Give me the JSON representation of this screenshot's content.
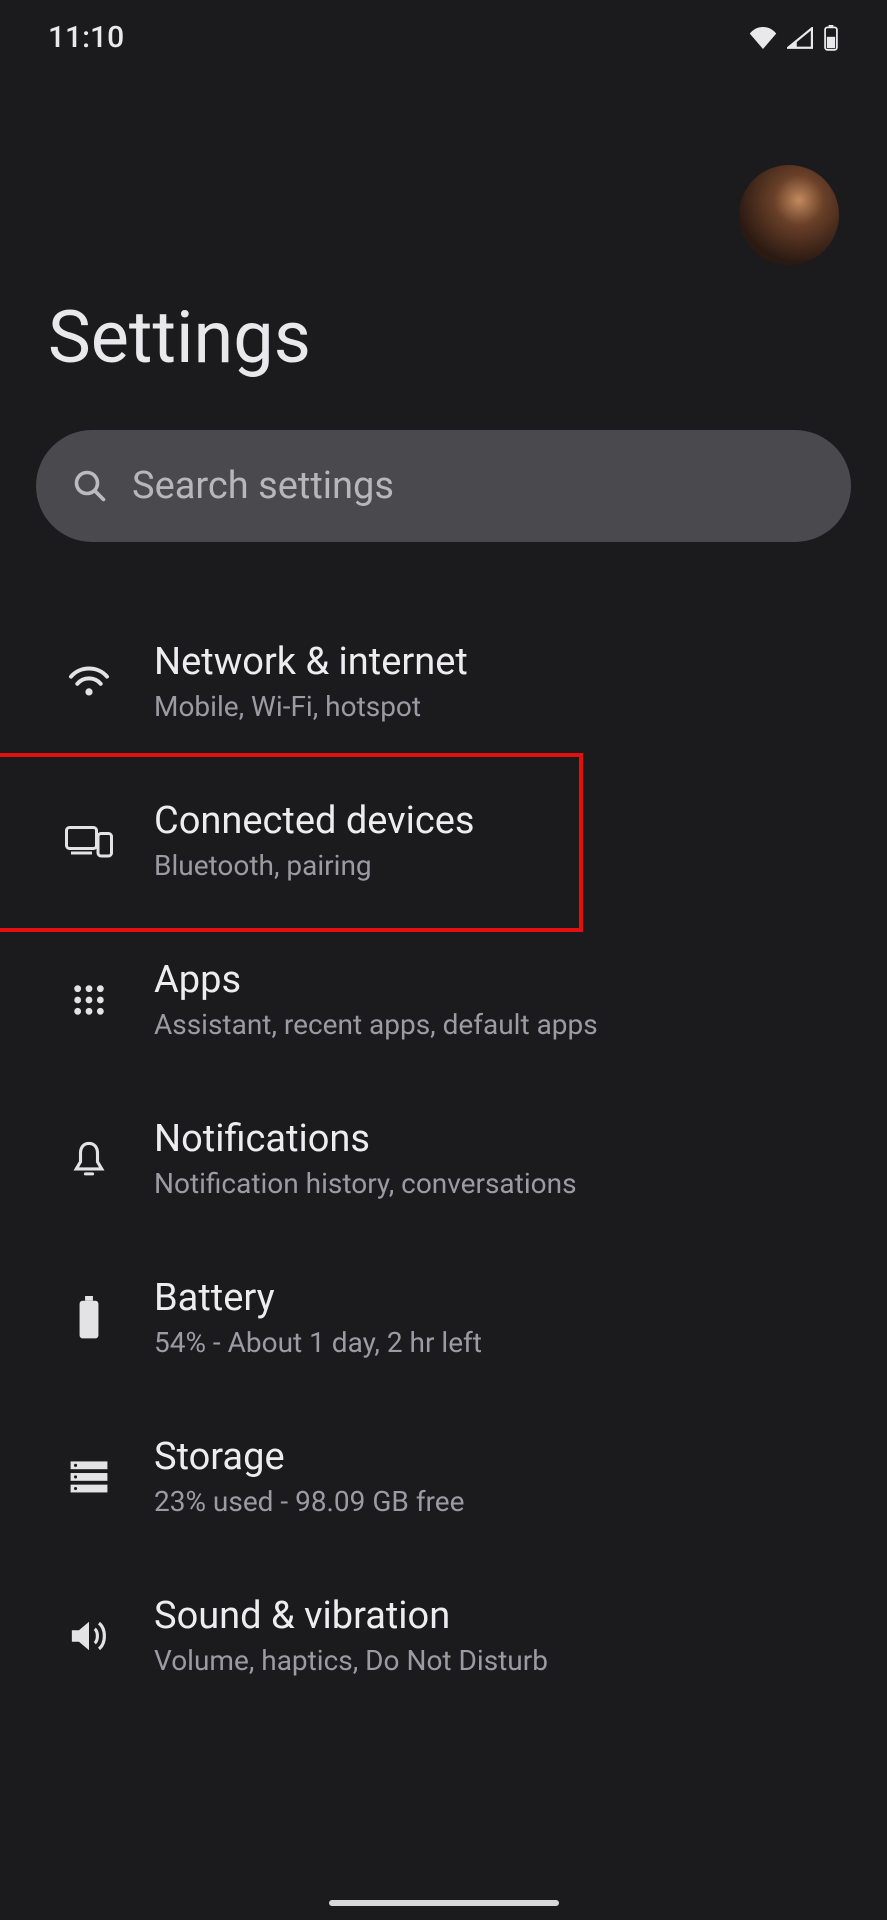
{
  "status": {
    "time": "11:10"
  },
  "header": {
    "title": "Settings"
  },
  "search": {
    "placeholder": "Search settings"
  },
  "items": [
    {
      "key": "network",
      "title": "Network & internet",
      "sub": "Mobile, Wi-Fi, hotspot"
    },
    {
      "key": "connected",
      "title": "Connected devices",
      "sub": "Bluetooth, pairing"
    },
    {
      "key": "apps",
      "title": "Apps",
      "sub": "Assistant, recent apps, default apps"
    },
    {
      "key": "notifications",
      "title": "Notifications",
      "sub": "Notification history, conversations"
    },
    {
      "key": "battery",
      "title": "Battery",
      "sub": "54% - About 1 day, 2 hr left"
    },
    {
      "key": "storage",
      "title": "Storage",
      "sub": "23% used - 98.09 GB free"
    },
    {
      "key": "sound",
      "title": "Sound & vibration",
      "sub": "Volume, haptics, Do Not Disturb"
    }
  ],
  "highlight": {
    "target": "connected"
  }
}
